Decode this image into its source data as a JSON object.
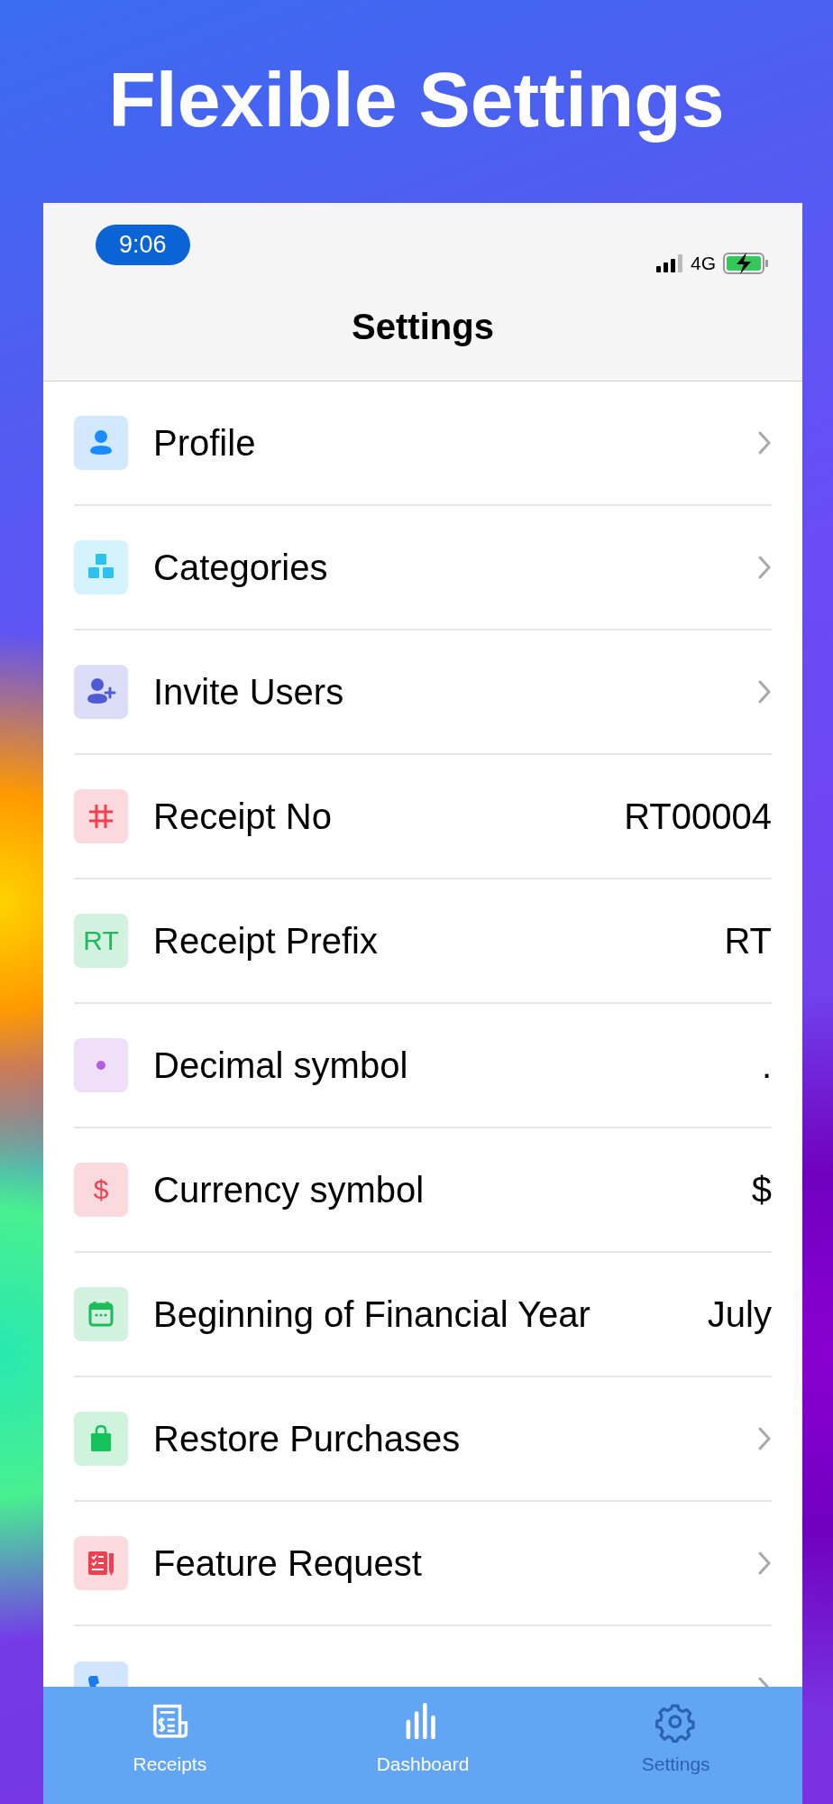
{
  "headline": "Flexible Settings",
  "status_bar": {
    "time": "9:06",
    "network": "4G"
  },
  "nav": {
    "title": "Settings"
  },
  "rows": [
    {
      "label": "Profile",
      "kind": "link",
      "color": "#1a8cff"
    },
    {
      "label": "Categories",
      "kind": "link",
      "color": "#2cc3f0"
    },
    {
      "label": "Invite Users",
      "kind": "link",
      "color": "#4f5bd5"
    },
    {
      "label": "Receipt No",
      "kind": "value",
      "value": "RT00004",
      "color": "#f0404f"
    },
    {
      "label": "Receipt Prefix",
      "kind": "value",
      "value": "RT",
      "color": "#1dbb5a",
      "icon_text": "RT"
    },
    {
      "label": "Decimal symbol",
      "kind": "value",
      "value": ".",
      "color": "#b45ee0"
    },
    {
      "label": "Currency symbol",
      "kind": "value",
      "value": "$",
      "color": "#f0404f",
      "icon_text": "$"
    },
    {
      "label": "Beginning of Financial Year",
      "kind": "value",
      "value": "July",
      "color": "#1dbb5a"
    },
    {
      "label": "Restore Purchases",
      "kind": "link",
      "color": "#14c45a"
    },
    {
      "label": "Feature Request",
      "kind": "link",
      "color": "#f0404f"
    },
    {
      "kind": "link",
      "color": "#1a7cf0"
    }
  ],
  "tabs": [
    {
      "label": "Receipts",
      "selected": false
    },
    {
      "label": "Dashboard",
      "selected": false
    },
    {
      "label": "Settings",
      "selected": true
    }
  ]
}
